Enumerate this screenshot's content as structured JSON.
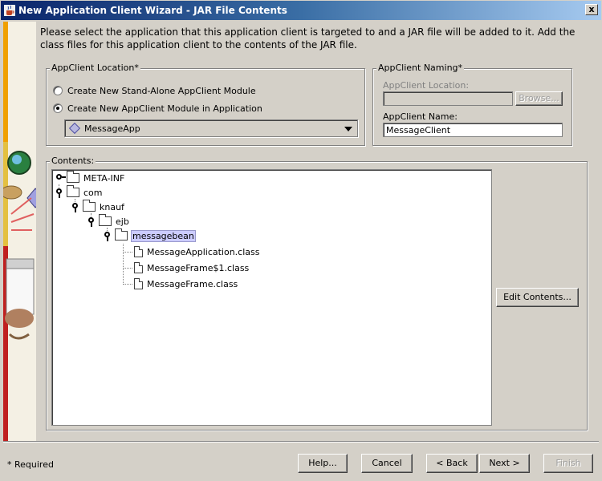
{
  "window": {
    "title": "New Application Client Wizard - JAR File Contents",
    "close_glyph": "x",
    "icon": "java-cup-icon"
  },
  "description": "Please select the application that this application client is targeted to and a JAR file will be added to it.  Add the class files for this application client to the contents of the JAR file.",
  "location": {
    "legend": "AppClient Location*",
    "options": [
      {
        "label": "Create New Stand-Alone AppClient Module",
        "selected": false
      },
      {
        "label": "Create New AppClient Module in Application",
        "selected": true
      }
    ],
    "application": "MessageApp"
  },
  "naming": {
    "legend": "AppClient Naming*",
    "location_label": "AppClient Location:",
    "location_value": "",
    "browse_label": "Browse...",
    "name_label": "AppClient Name:",
    "name_value": "MessageClient"
  },
  "contents": {
    "legend": "Contents:",
    "tree": [
      {
        "label": "META-INF",
        "type": "folder",
        "handle": "closed"
      },
      {
        "label": "com",
        "type": "folder",
        "handle": "open"
      },
      {
        "label": "knauf",
        "type": "folder",
        "handle": "open"
      },
      {
        "label": "ejb",
        "type": "folder",
        "handle": "open"
      },
      {
        "label": "messagebean",
        "type": "folder",
        "handle": "open",
        "selected": true
      },
      {
        "label": "MessageApplication.class",
        "type": "file"
      },
      {
        "label": "MessageFrame$1.class",
        "type": "file"
      },
      {
        "label": "MessageFrame.class",
        "type": "file"
      }
    ],
    "edit_label": "Edit Contents..."
  },
  "footer": {
    "required_note": "* Required",
    "help_label": "Help...",
    "cancel_label": "Cancel",
    "back_label": "< Back",
    "next_label": "Next >",
    "finish_label": "Finish"
  }
}
